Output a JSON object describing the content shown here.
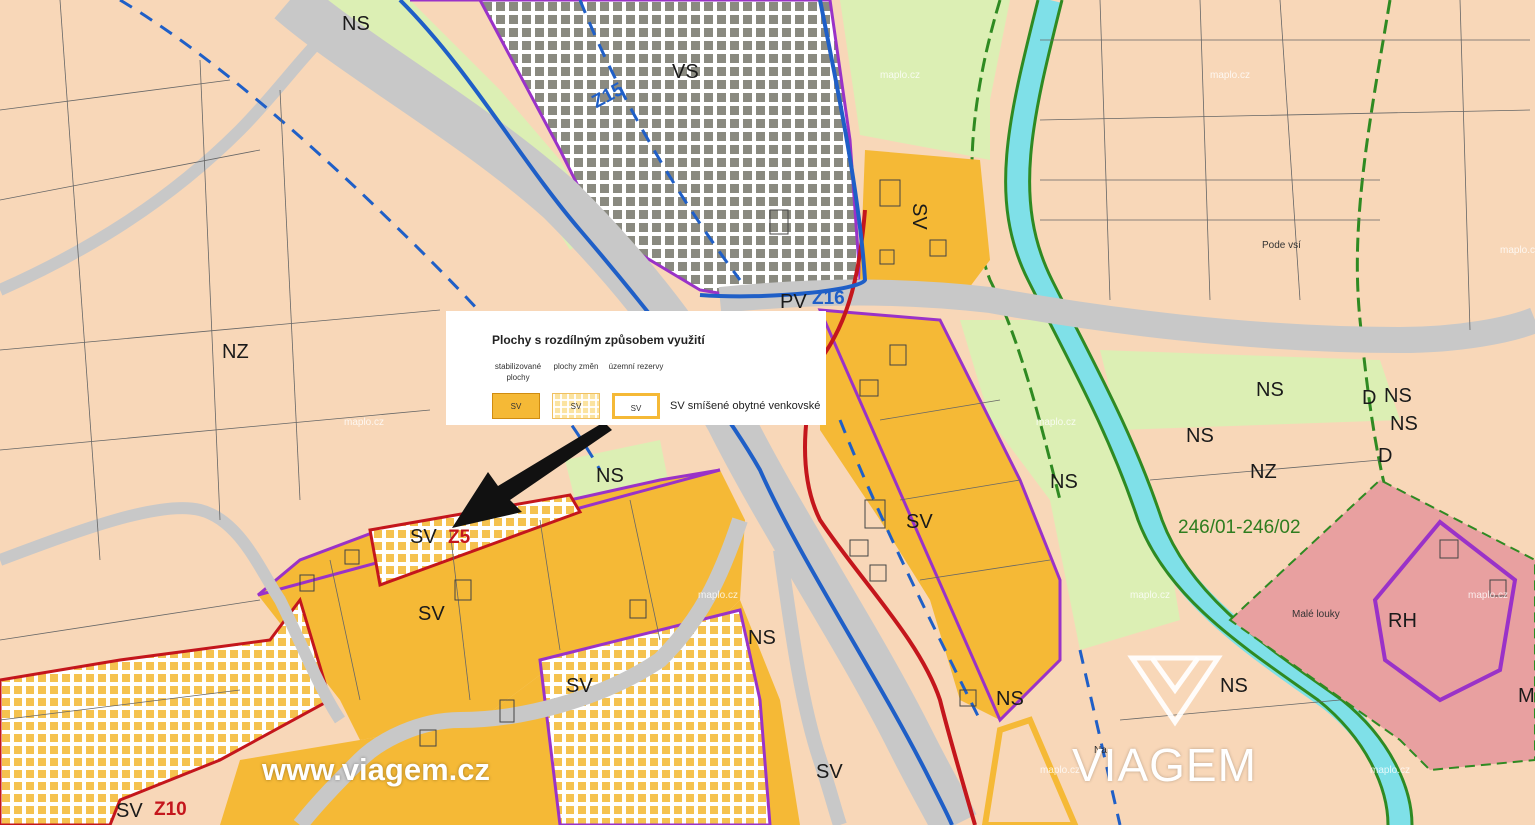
{
  "map": {
    "zone_labels": {
      "ns_top": "NS",
      "vs": "VS",
      "z15": "Z15",
      "sv_vertical": "SV",
      "pv": "PV",
      "z16": "Z16",
      "nz_left": "NZ",
      "ns_box": "NS",
      "sv_small": "SV",
      "z5": "Z5",
      "sv_mid": "SV",
      "sv_center": "SV",
      "ns_road": "NS",
      "sv_right": "SV",
      "ns_right_field": "NS",
      "ns_river": "NS",
      "ns_d1": "NS",
      "d1": "D",
      "ns_d2": "NS",
      "nz_right": "NZ",
      "d2": "D",
      "parcels": "246/01-246/02",
      "rh": "RH",
      "ns_low": "NS",
      "ns_riverbank": "NS",
      "sv_bottom_mid": "SV",
      "sv_bottom_left": "SV",
      "z10": "Z10",
      "m_edge": "M"
    },
    "place_names": {
      "pode_vsi": "Pode vsí",
      "male_louky": "Malé louky",
      "na": "Na"
    },
    "watermark": "maplo.cz"
  },
  "legend": {
    "title": "Plochy s rozdílným způsobem využití",
    "col_stabilized": "stabilizované plochy",
    "col_changes": "plochy změn",
    "col_reserves": "územní rezervy",
    "swatch_code": "SV",
    "description": "SV smíšené obytné venkovské"
  },
  "branding": {
    "website": "www.viagem.cz",
    "logo_text": "VIAGEM"
  },
  "colors": {
    "background": "#f8d7b8",
    "residential": "#f5b936",
    "greenery": "#dcefb4",
    "road": "#c8c8c8",
    "river": "#7fe0e8",
    "recreation": "#e8a0a0",
    "boundary_purple": "#9a32c8",
    "boundary_blue": "#1f5fc7",
    "boundary_red": "#c4161c",
    "boundary_green": "#2f8a22"
  }
}
